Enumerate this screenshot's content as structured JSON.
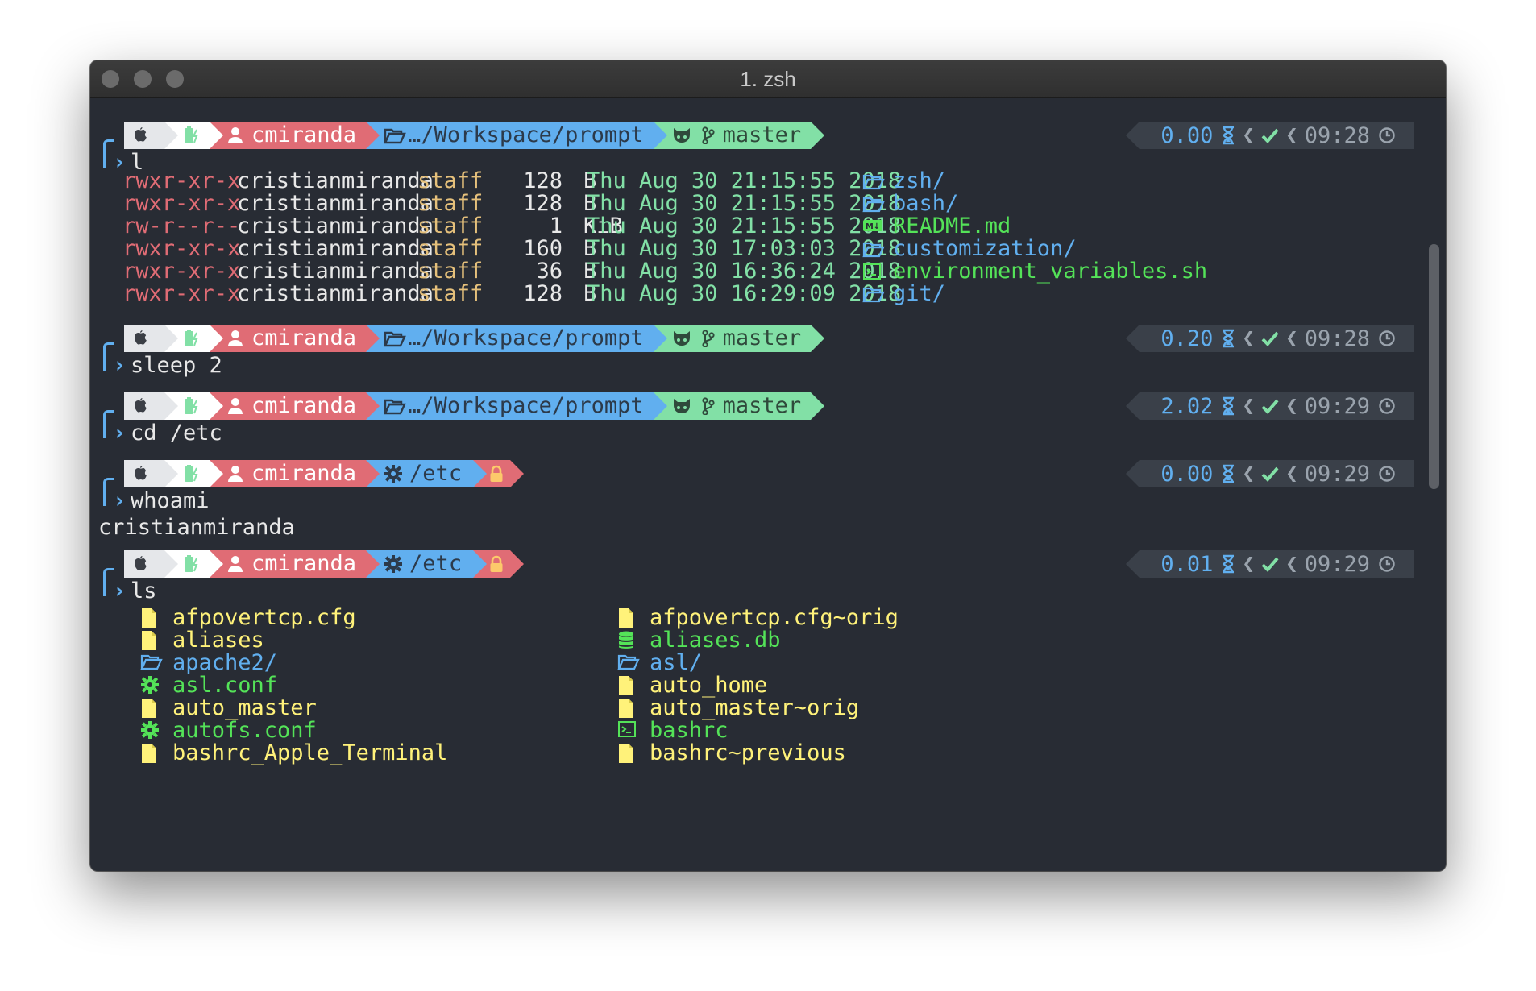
{
  "window": {
    "title": "1. zsh"
  },
  "prompts": [
    {
      "user": "cmiranda",
      "dir": "…/Workspace/prompt",
      "branch": "master",
      "duration": "0.00",
      "time": "09:28",
      "command": "l"
    },
    {
      "user": "cmiranda",
      "dir": "…/Workspace/prompt",
      "branch": "master",
      "duration": "0.20",
      "time": "09:28",
      "command": "sleep 2"
    },
    {
      "user": "cmiranda",
      "dir": "…/Workspace/prompt",
      "branch": "master",
      "duration": "2.02",
      "time": "09:29",
      "command": "cd /etc"
    },
    {
      "user": "cmiranda",
      "dir": "/etc",
      "branch": "",
      "duration": "0.00",
      "time": "09:29",
      "command": "whoami"
    },
    {
      "user": "cmiranda",
      "dir": "/etc",
      "branch": "",
      "duration": "0.01",
      "time": "09:29",
      "command": "ls"
    }
  ],
  "long_listing": [
    {
      "perm": "rwxr-xr-x",
      "owner": "cristianmiranda",
      "group": "staff",
      "size": "128",
      "unit": "B",
      "date": "Thu Aug 30 21:15:55 2018",
      "icon": "folder-icon",
      "name": "zsh/"
    },
    {
      "perm": "rwxr-xr-x",
      "owner": "cristianmiranda",
      "group": "staff",
      "size": "128",
      "unit": "B",
      "date": "Thu Aug 30 21:15:55 2018",
      "icon": "folder-icon",
      "name": "bash/"
    },
    {
      "perm": "rw-r--r--",
      "owner": "cristianmiranda",
      "group": "staff",
      "size": "1",
      "unit": "KiB",
      "date": "Thu Aug 30 21:15:55 2018",
      "icon": "markdown-icon",
      "name": "README.md"
    },
    {
      "perm": "rwxr-xr-x",
      "owner": "cristianmiranda",
      "group": "staff",
      "size": "160",
      "unit": "B",
      "date": "Thu Aug 30 17:03:03 2018",
      "icon": "folder-icon",
      "name": "customization/"
    },
    {
      "perm": "rwxr-xr-x",
      "owner": "cristianmiranda",
      "group": "staff",
      "size": "36",
      "unit": "B",
      "date": "Thu Aug 30 16:36:24 2018",
      "icon": "terminal-icon",
      "name": "environment_variables.sh"
    },
    {
      "perm": "rwxr-xr-x",
      "owner": "cristianmiranda",
      "group": "staff",
      "size": "128",
      "unit": "B",
      "date": "Thu Aug 30 16:29:09 2018",
      "icon": "folder-icon",
      "name": "git/"
    }
  ],
  "whoami_output": "cristianmiranda",
  "ls_listing": [
    {
      "icon": "file-icon",
      "name": "afpovertcp.cfg",
      "color": "yellow"
    },
    {
      "icon": "file-icon",
      "name": "afpovertcp.cfg~orig",
      "color": "yellow"
    },
    {
      "icon": "file-icon",
      "name": "aliases",
      "color": "yellow"
    },
    {
      "icon": "database-icon",
      "name": "aliases.db",
      "color": "green"
    },
    {
      "icon": "folder-icon",
      "name": "apache2/",
      "color": "blue"
    },
    {
      "icon": "folder-icon",
      "name": "asl/",
      "color": "blue"
    },
    {
      "icon": "gear-icon",
      "name": "asl.conf",
      "color": "green"
    },
    {
      "icon": "file-icon",
      "name": "auto_home",
      "color": "yellow"
    },
    {
      "icon": "file-icon",
      "name": "auto_master",
      "color": "yellow"
    },
    {
      "icon": "file-icon",
      "name": "auto_master~orig",
      "color": "yellow"
    },
    {
      "icon": "gear-icon",
      "name": "autofs.conf",
      "color": "green"
    },
    {
      "icon": "terminal-icon",
      "name": "bashrc",
      "color": "green"
    },
    {
      "icon": "file-icon",
      "name": "bashrc_Apple_Terminal",
      "color": "yellow"
    },
    {
      "icon": "file-icon",
      "name": "bashrc~previous",
      "color": "yellow"
    }
  ],
  "colors": {
    "background": "#282c34",
    "user_segment": "#e06c75",
    "dir_segment": "#61afef",
    "git_segment": "#82e0a6",
    "status_segment": "#3a4049",
    "file_yellow": "#fff27a",
    "file_green": "#54e358"
  }
}
